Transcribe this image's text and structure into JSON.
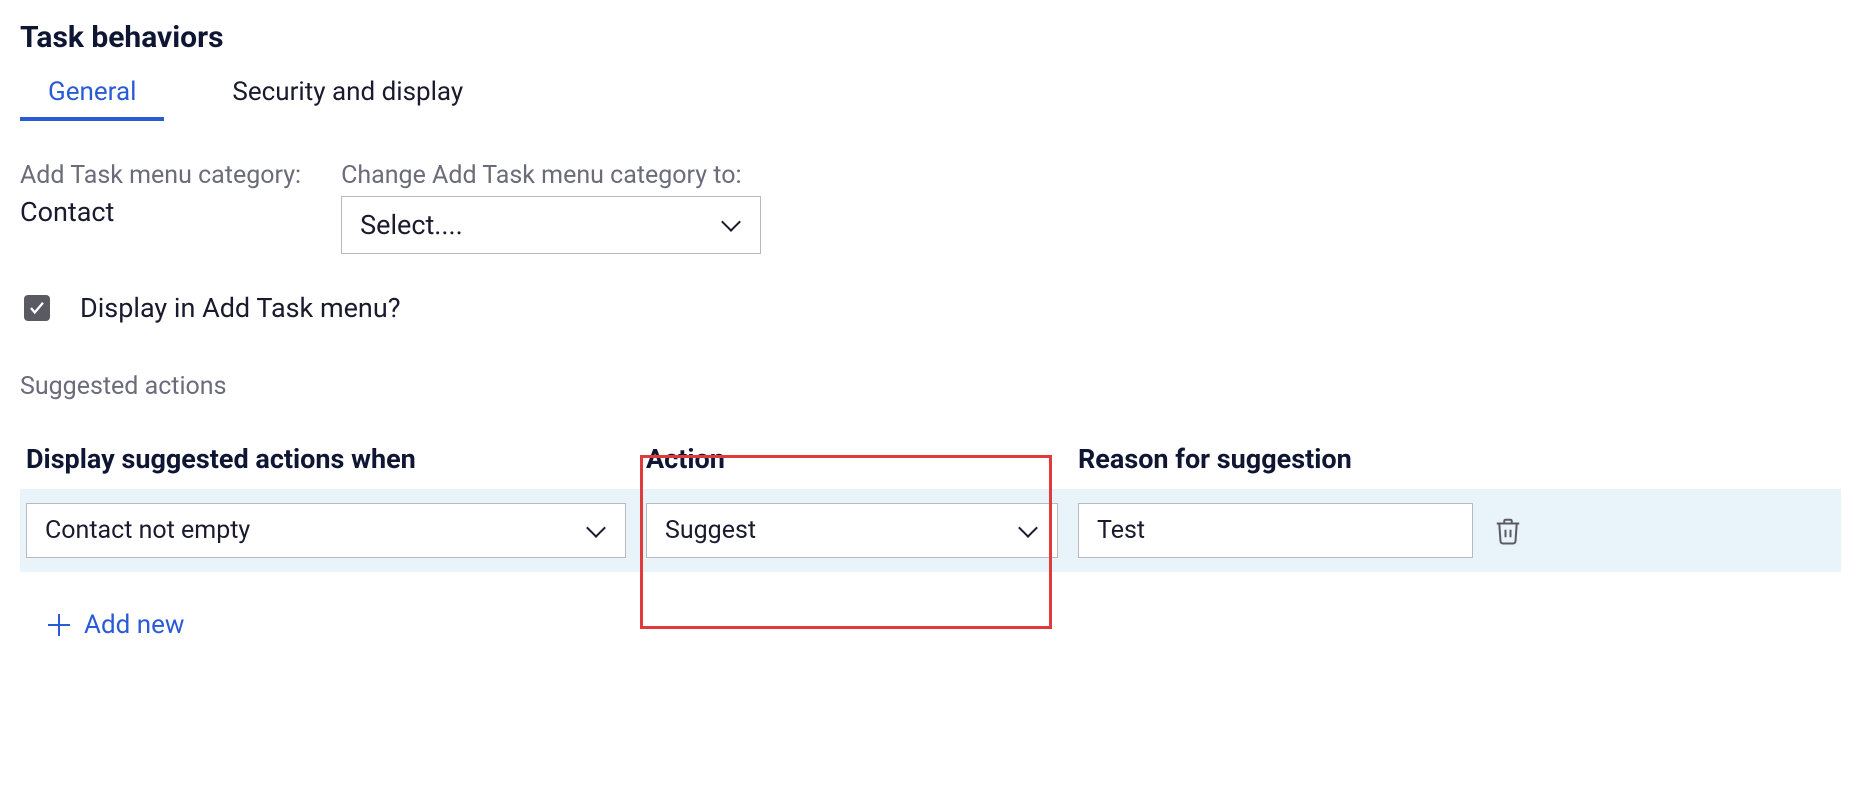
{
  "header": {
    "title": "Task behaviors"
  },
  "tabs": {
    "general": "General",
    "security": "Security and display"
  },
  "fields": {
    "category_label": "Add Task menu category:",
    "category_value": "Contact",
    "change_label": "Change Add Task menu category to:",
    "change_placeholder": "Select....",
    "display_checkbox_label": "Display in Add Task menu?"
  },
  "section": {
    "suggested_label": "Suggested actions"
  },
  "table": {
    "headers": {
      "when": "Display suggested actions when",
      "action": "Action",
      "reason": "Reason for suggestion"
    },
    "row": {
      "when_value": "Contact not empty",
      "action_value": "Suggest",
      "reason_value": "Test"
    },
    "add_new": "Add new"
  }
}
